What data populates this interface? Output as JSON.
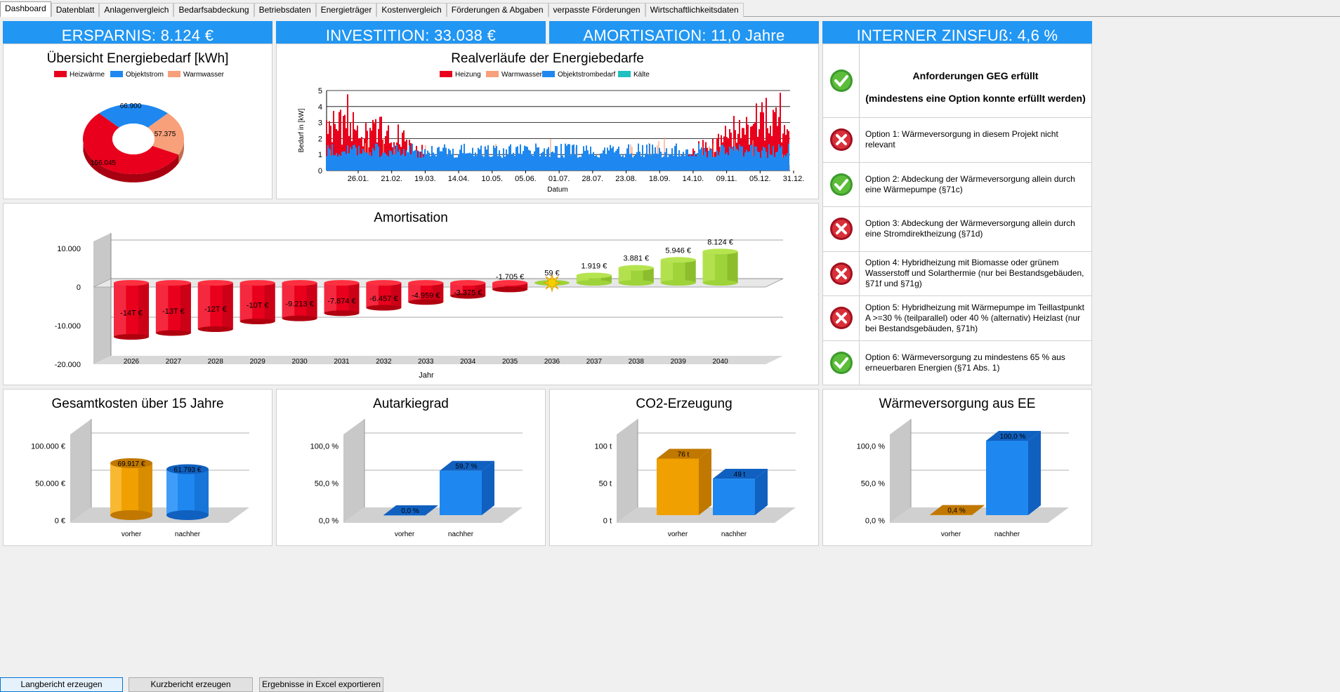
{
  "tabs": [
    "Dashboard",
    "Datenblatt",
    "Anlagenvergleich",
    "Bedarfsabdeckung",
    "Betriebsdaten",
    "Energieträger",
    "Kostenvergleich",
    "Förderungen & Abgaben",
    "verpasste Förderungen",
    "Wirtschaftlichkeitsdaten"
  ],
  "kpis": {
    "ersparnis": "ERSPARNIS: 8.124 €",
    "investition": "INVESTITION: 33.038 €",
    "amortisation": "AMORTISATION: 11,0 Jahre",
    "zinsfuss": "INTERNER ZINSFUß: 4,6 %"
  },
  "colors": {
    "accent": "#2196f3",
    "red": "#e8001c",
    "green": "#9ed33a",
    "orange": "#f0a000",
    "blue": "#1e88f0"
  },
  "donut": {
    "title": "Übersicht Energiebedarf [kWh]",
    "legend": [
      "Heizwärme",
      "Objektstrom",
      "Warmwasser"
    ],
    "labels": [
      "156.045",
      "66.900",
      "57.375"
    ],
    "chart_data": {
      "type": "pie",
      "categories": [
        "Heizwärme",
        "Objektstrom",
        "Warmwasser"
      ],
      "values": [
        156045,
        66900,
        57375
      ]
    }
  },
  "realverlauf": {
    "title": "Realverläufe der Energiebedarfe",
    "legend": [
      "Heizung",
      "Warmwasser",
      "Objektstrombedarf",
      "Kälte"
    ],
    "ylabel": "Bedarf in [kW]",
    "xlabel": "Datum",
    "yticks": [
      "0",
      "1",
      "2",
      "3",
      "4",
      "5"
    ],
    "xticks": [
      "26.01.",
      "21.02.",
      "19.03.",
      "14.04.",
      "10.05.",
      "05.06.",
      "01.07.",
      "28.07.",
      "23.08.",
      "18.09.",
      "14.10.",
      "09.11.",
      "05.12.",
      "31.12."
    ],
    "chart_data": {
      "type": "area",
      "ylim": [
        0,
        5
      ],
      "series": [
        {
          "name": "Heizung"
        },
        {
          "name": "Warmwasser"
        },
        {
          "name": "Objektstrombedarf"
        },
        {
          "name": "Kälte"
        }
      ]
    }
  },
  "amortisation": {
    "title": "Amortisation",
    "xlabel": "Jahr",
    "yticks": [
      "10.000",
      "0",
      "-10.000",
      "-20.000"
    ],
    "years": [
      "2026",
      "2027",
      "2028",
      "2029",
      "2030",
      "2031",
      "2032",
      "2033",
      "2034",
      "2035",
      "2036",
      "2037",
      "2038",
      "2039",
      "2040"
    ],
    "labels": [
      "-14T €",
      "-13T €",
      "-12T €",
      "-10T €",
      "-9.213 €",
      "-7.874 €",
      "-6.457 €",
      "-4.959 €",
      "-3.375 €",
      "-1.705 €",
      "59 €",
      "1.919 €",
      "3.881 €",
      "5.946 €",
      "8.124 €"
    ],
    "chart_data": {
      "type": "bar",
      "categories": [
        "2026",
        "2027",
        "2028",
        "2029",
        "2030",
        "2031",
        "2032",
        "2033",
        "2034",
        "2035",
        "2036",
        "2037",
        "2038",
        "2039",
        "2040"
      ],
      "values": [
        -14000,
        -13000,
        -12000,
        -10000,
        -9213,
        -7874,
        -6457,
        -4959,
        -3375,
        -1705,
        59,
        1919,
        3881,
        5946,
        8124
      ],
      "ylim": [
        -20000,
        10000
      ]
    }
  },
  "geg": {
    "header1": "Anforderungen GEG erfüllt",
    "header2": "(mindestens eine Option konnte erfüllt werden)",
    "options": [
      {
        "ok": false,
        "text": "Option 1: Wärmeversorgung in diesem Projekt nicht relevant"
      },
      {
        "ok": true,
        "text": "Option 2: Abdeckung der Wärmeversorgung allein durch eine Wärmepumpe (§71c)"
      },
      {
        "ok": false,
        "text": "Option 3: Abdeckung der Wärmeversorgung allein durch eine Stromdirektheizung (§71d)"
      },
      {
        "ok": false,
        "text": "Option 4: Hybridheizung mit Biomasse oder grünem Wasserstoff und Solarthermie (nur bei Bestandsgebäuden, §71f und §71g)"
      },
      {
        "ok": false,
        "text": "Option 5: Hybridheizung mit Wärmepumpe im Teillastpunkt A >=30 % (teilparallel) oder 40 % (alternativ) Heizlast (nur bei Bestandsgebäuden, §71h)"
      },
      {
        "ok": true,
        "text": "Option 6: Wärmeversorgung zu mindestens 65 % aus erneuerbaren Energien (§71 Abs. 1)"
      }
    ]
  },
  "gesamtkosten": {
    "title": "Gesamtkosten über 15 Jahre",
    "categories": [
      "vorher",
      "nachher"
    ],
    "labels": [
      "69.917 €",
      "61.793 €"
    ],
    "yticks": [
      "100.000 €",
      "50.000 €",
      "0 €"
    ],
    "chart_data": {
      "type": "bar",
      "categories": [
        "vorher",
        "nachher"
      ],
      "values": [
        69917,
        61793
      ],
      "ylim": [
        0,
        100000
      ]
    }
  },
  "autarkie": {
    "title": "Autarkiegrad",
    "categories": [
      "vorher",
      "nachher"
    ],
    "labels": [
      "0,0 %",
      "59,7 %"
    ],
    "yticks": [
      "100,0 %",
      "50,0 %",
      "0,0 %"
    ],
    "chart_data": {
      "type": "bar",
      "categories": [
        "vorher",
        "nachher"
      ],
      "values": [
        0,
        59.7
      ],
      "ylim": [
        0,
        100
      ]
    }
  },
  "co2": {
    "title": "CO2-Erzeugung",
    "categories": [
      "vorher",
      "nachher"
    ],
    "labels": [
      "76 t",
      "49 t"
    ],
    "yticks": [
      "100 t",
      "50 t",
      "0 t"
    ],
    "chart_data": {
      "type": "bar",
      "categories": [
        "vorher",
        "nachher"
      ],
      "values": [
        76,
        49
      ],
      "ylim": [
        0,
        100
      ]
    }
  },
  "waerme_ee": {
    "title": "Wärmeversorgung aus EE",
    "categories": [
      "vorher",
      "nachher"
    ],
    "labels": [
      "0,4 %",
      "100,0 %"
    ],
    "yticks": [
      "100,0 %",
      "50,0 %",
      "0,0 %"
    ],
    "chart_data": {
      "type": "bar",
      "categories": [
        "vorher",
        "nachher"
      ],
      "values": [
        0.4,
        100
      ],
      "ylim": [
        0,
        100
      ]
    }
  },
  "buttons": {
    "lang": "Langbericht erzeugen",
    "kurz": "Kurzbericht erzeugen",
    "excel": "Ergebnisse in Excel exportieren"
  }
}
